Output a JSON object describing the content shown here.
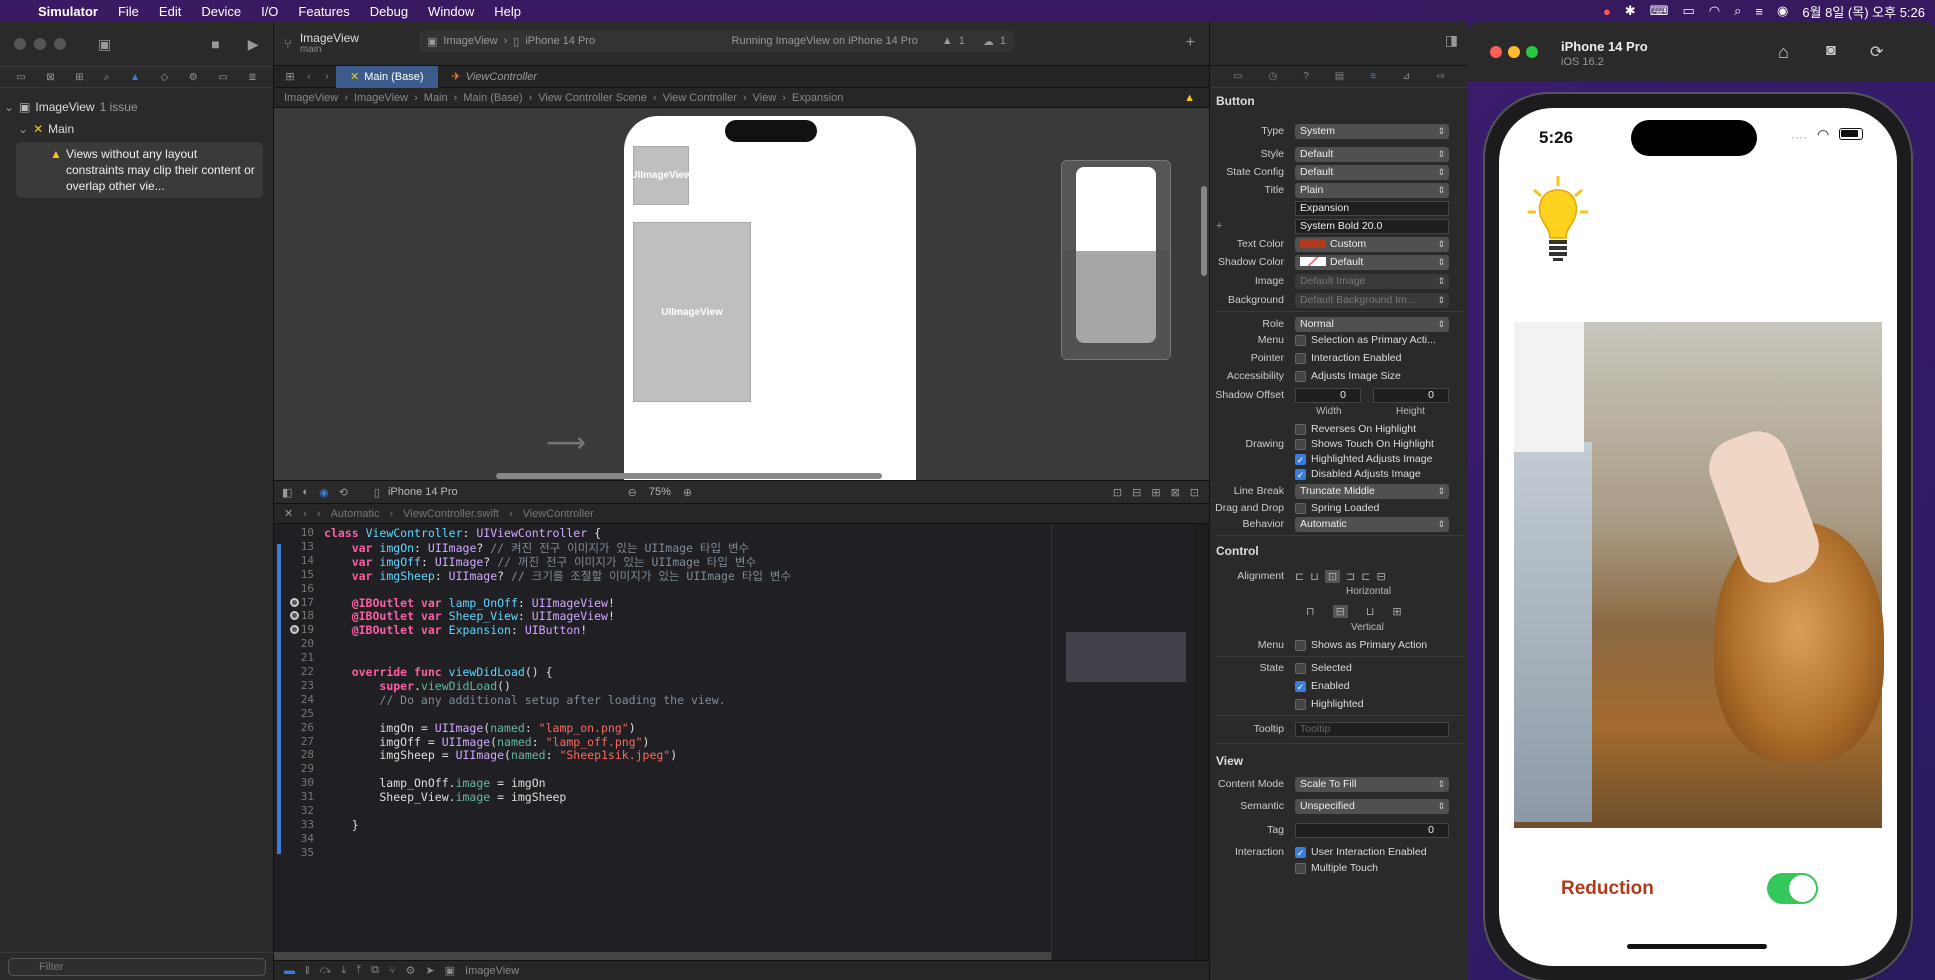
{
  "menubar": {
    "app": "Simulator",
    "items": [
      "File",
      "Edit",
      "Device",
      "I/O",
      "Features",
      "Debug",
      "Window",
      "Help"
    ],
    "clock": "6월 8일 (목) 오후 5:26"
  },
  "toolbar": {
    "scheme_title": "ImageView",
    "scheme_branch": "main",
    "destination_scheme": "ImageView",
    "destination_device": "iPhone 14 Pro",
    "status": "Running ImageView on iPhone 14 Pro",
    "warnings": "1",
    "issues": "1"
  },
  "navigator": {
    "project": "ImageView",
    "project_issues": "1 issue",
    "group": "Main",
    "issue_text": "Views without any layout constraints may clip their content or overlap other vie...",
    "filter_placeholder": "Filter"
  },
  "tabs": {
    "active": "Main (Base)",
    "inactive": "ViewController"
  },
  "jumpbar_top": [
    "ImageView",
    "ImageView",
    "Main",
    "Main (Base)",
    "View Controller Scene",
    "View Controller",
    "View",
    "Expansion"
  ],
  "canvas": {
    "imageview_small": "UIImageView",
    "imageview_large": "UIImageView",
    "device_label": "iPhone 14 Pro",
    "zoom": "75%"
  },
  "jumpbar_code": [
    "Automatic",
    "ViewController.swift",
    "ViewController"
  ],
  "bottom_scheme": "ImageView",
  "inspector": {
    "section_button": "Button",
    "type": "System",
    "style": "Default",
    "state_config": "Default",
    "title_mode": "Plain",
    "title_text": "Expansion",
    "font": "System Bold 20.0",
    "text_color": "Custom",
    "shadow_color": "Default",
    "image_placeholder": "Default Image",
    "background_placeholder": "Default Background Im...",
    "role": "Normal",
    "menu_opt": "Selection as Primary Acti...",
    "pointer_opt": "Interaction Enabled",
    "accessibility_opt": "Adjusts Image Size",
    "shadow_w": "0",
    "shadow_h": "0",
    "width_label": "Width",
    "height_label": "Height",
    "drawing": [
      "Reverses On Highlight",
      "Shows Touch On Highlight",
      "Highlighted Adjusts Image",
      "Disabled Adjusts Image"
    ],
    "line_break": "Truncate Middle",
    "drag_drop": "Spring Loaded",
    "behavior": "Automatic",
    "section_control": "Control",
    "horizontal": "Horizontal",
    "vertical": "Vertical",
    "control_menu": "Shows as Primary Action",
    "state": [
      "Selected",
      "Enabled",
      "Highlighted"
    ],
    "tooltip_placeholder": "Tooltip",
    "section_view": "View",
    "content_mode": "Scale To Fill",
    "semantic": "Unspecified",
    "tag": "0",
    "interaction": [
      "User Interaction Enabled",
      "Multiple Touch"
    ],
    "labels": {
      "type": "Type",
      "style": "Style",
      "state_config": "State Config",
      "title": "Title",
      "text_color": "Text Color",
      "shadow_color": "Shadow Color",
      "image": "Image",
      "background": "Background",
      "role": "Role",
      "menu": "Menu",
      "pointer": "Pointer",
      "accessibility": "Accessibility",
      "shadow_offset": "Shadow Offset",
      "drawing": "Drawing",
      "line_break": "Line Break",
      "drag_drop": "Drag and Drop",
      "behavior": "Behavior",
      "alignment": "Alignment",
      "control_menu": "Menu",
      "state": "State",
      "tooltip": "Tooltip",
      "content_mode": "Content Mode",
      "semantic": "Semantic",
      "tag": "Tag",
      "interaction": "Interaction"
    }
  },
  "code": [
    {
      "n": "10",
      "html": "<span class='kw'>class</span> <span class='id'>ViewController</span>: <span class='ty'>UIViewController</span> {"
    },
    {
      "n": "13",
      "html": "    <span class='kw'>var</span> <span class='id'>imgOn</span>: <span class='ty'>UIImage</span>? <span class='cm'>// 켜진 전구 이미지가 있는 UIImage 타입 변수</span>"
    },
    {
      "n": "14",
      "html": "    <span class='kw'>var</span> <span class='id'>imgOff</span>: <span class='ty'>UIImage</span>? <span class='cm'>// 꺼진 전구 이미지가 있는 UIImage 타입 변수</span>"
    },
    {
      "n": "15",
      "html": "    <span class='kw'>var</span> <span class='id'>imgSheep</span>: <span class='ty'>UIImage</span>? <span class='cm'>// 크기를 조절할 이미지가 있는 UIImage 타입 변수</span>"
    },
    {
      "n": "16",
      "html": ""
    },
    {
      "n": "17",
      "html": "    <span class='kw'>@IBOutlet var</span> <span class='id'>lamp_OnOff</span>: <span class='ty'>UIImageView</span>!"
    },
    {
      "n": "18",
      "html": "    <span class='kw'>@IBOutlet var</span> <span class='id'>Sheep_View</span>: <span class='ty'>UIImageView</span>!"
    },
    {
      "n": "19",
      "html": "    <span class='kw'>@IBOutlet var</span> <span class='id'>Expansion</span>: <span class='ty'>UIButton</span>!"
    },
    {
      "n": "20",
      "html": ""
    },
    {
      "n": "21",
      "html": ""
    },
    {
      "n": "22",
      "html": "    <span class='kw'>override func</span> <span class='id'>viewDidLoad</span>() {"
    },
    {
      "n": "23",
      "html": "        <span class='kw'>super</span>.<span class='fn'>viewDidLoad</span>()"
    },
    {
      "n": "24",
      "html": "        <span class='cm'>// Do any additional setup after loading the view.</span>"
    },
    {
      "n": "25",
      "html": ""
    },
    {
      "n": "26",
      "html": "        imgOn = <span class='ty'>UIImage</span>(<span class='fn'>named</span>: <span class='st'>\"lamp_on.png\"</span>)"
    },
    {
      "n": "27",
      "html": "        imgOff = <span class='ty'>UIImage</span>(<span class='fn'>named</span>: <span class='st'>\"lamp_off.png\"</span>)"
    },
    {
      "n": "28",
      "html": "        imgSheep = <span class='ty'>UIImage</span>(<span class='fn'>named</span>: <span class='st'>\"Sheep1sik.jpeg\"</span>)"
    },
    {
      "n": "29",
      "html": ""
    },
    {
      "n": "30",
      "html": "        lamp_OnOff.<span class='fn'>image</span> = imgOn"
    },
    {
      "n": "31",
      "html": "        Sheep_View.<span class='fn'>image</span> = imgSheep"
    },
    {
      "n": "32",
      "html": ""
    },
    {
      "n": "33",
      "html": "    }"
    },
    {
      "n": "34",
      "html": ""
    },
    {
      "n": "35",
      "html": ""
    }
  ],
  "simulator": {
    "device": "iPhone 14 Pro",
    "os": "iOS 16.2",
    "time": "5:26",
    "reduction_label": "Reduction",
    "toggle_on": true
  },
  "colors": {
    "accent": "#3b7ddc",
    "button_text": "#b23a1a",
    "switch_on": "#34c759"
  }
}
